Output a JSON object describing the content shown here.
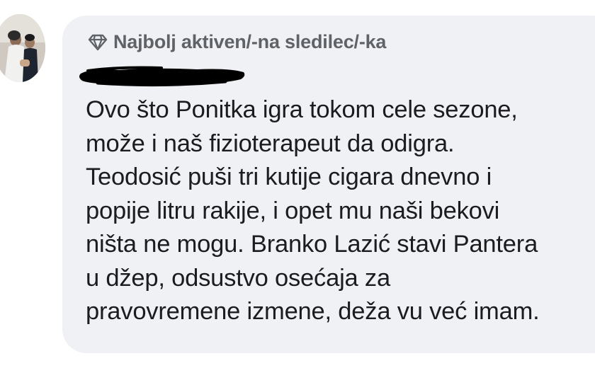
{
  "comment": {
    "author_badge": {
      "icon": "diamond-icon",
      "label": "Najbolj aktiven/-na sledilec/-ka"
    },
    "author_name_redacted": true,
    "text_lines": [
      "Ovo što Ponitka igra tokom cele sezone,",
      "može i naš fizioterapeut da odigra.",
      "Teodosić puši tri kutije cigara dnevno i",
      "popije litru rakije, i opet mu naši bekovi",
      "ništa ne mogu. Branko Lazić stavi Pantera",
      "u džep, odsustvo osećaja za",
      "pravovremene izmene, deža vu već imam."
    ]
  },
  "colors": {
    "bubble_background": "#eff1f5",
    "badge_text": "#5f6368",
    "body_text": "#1c1c1e",
    "redaction": "#000000"
  }
}
